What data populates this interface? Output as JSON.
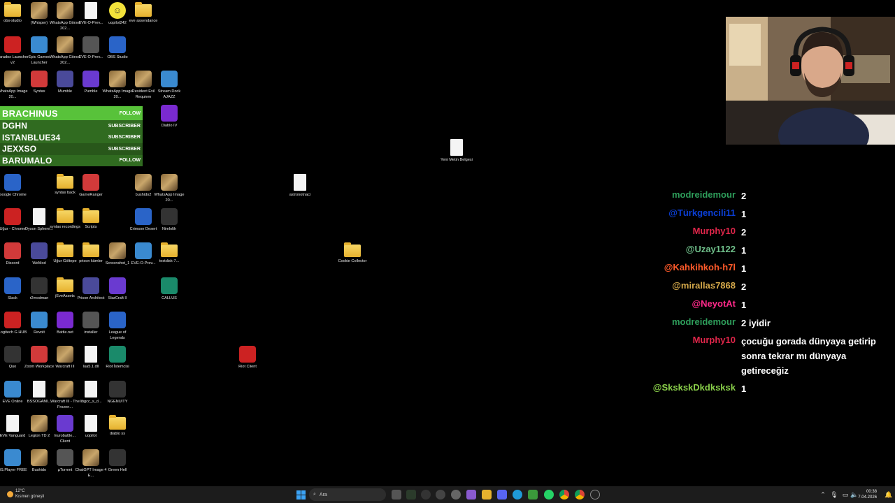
{
  "desktop_icons": [
    {
      "label": "obs-studio",
      "kind": "folder"
    },
    {
      "label": "(Whisper)",
      "kind": "photo"
    },
    {
      "label": "WhatsApp Görsel 202...",
      "kind": "photo"
    },
    {
      "label": "EVE-O-Prev...",
      "kind": "file"
    },
    {
      "label": "uopilot242",
      "kind": "smiley"
    },
    {
      "label": "eve assendance",
      "kind": "folder"
    },
    {
      "label": "Paradox Launcher v2",
      "kind": "app"
    },
    {
      "label": "Epic Games Launcher",
      "kind": "app"
    },
    {
      "label": "WhatsApp Görsel 202...",
      "kind": "photo"
    },
    {
      "label": "EVE-O-Prev...",
      "kind": "app"
    },
    {
      "label": "OBS Studio",
      "kind": "app"
    },
    {
      "label": "WhatsApp Image 20...",
      "kind": "photo"
    },
    {
      "label": "Syntax",
      "kind": "app"
    },
    {
      "label": "Mumble",
      "kind": "app"
    },
    {
      "label": "Pumble",
      "kind": "app"
    },
    {
      "label": "WhatsApp Image 20...",
      "kind": "photo"
    },
    {
      "label": "Resident Evil Requiem",
      "kind": "photo"
    },
    {
      "label": "Stream Dock AJAZZ",
      "kind": "app"
    },
    {
      "label": "Diablo IV",
      "kind": "app"
    },
    {
      "label": "Yeni Metin Belgesi",
      "kind": "file"
    },
    {
      "label": "Google Chrome",
      "kind": "app"
    },
    {
      "label": "syntax back",
      "kind": "folder"
    },
    {
      "label": "GameRanger",
      "kind": "app"
    },
    {
      "label": "bushido2",
      "kind": "photo"
    },
    {
      "label": "WhatsApp Image 20...",
      "kind": "photo"
    },
    {
      "label": "astronotnaci",
      "kind": "file"
    },
    {
      "label": "Uğur - Chrome",
      "kind": "app"
    },
    {
      "label": "Dyson Sphere...",
      "kind": "file"
    },
    {
      "label": "syntax recordings",
      "kind": "folder"
    },
    {
      "label": "Scripts",
      "kind": "folder"
    },
    {
      "label": "Crimson Desert",
      "kind": "app"
    },
    {
      "label": "Nimlolth",
      "kind": "app"
    },
    {
      "label": "Discord",
      "kind": "app"
    },
    {
      "label": "WeMod",
      "kind": "app"
    },
    {
      "label": "Uğur Göltepe",
      "kind": "folder"
    },
    {
      "label": "prison kümler",
      "kind": "folder"
    },
    {
      "label": "Screenshot_1",
      "kind": "photo"
    },
    {
      "label": "EVE-O-Prev...",
      "kind": "app"
    },
    {
      "label": "testdisk-7...",
      "kind": "folder"
    },
    {
      "label": "Cookie Collector",
      "kind": "folder"
    },
    {
      "label": "Slack",
      "kind": "app"
    },
    {
      "label": "r2modman",
      "kind": "app"
    },
    {
      "label": "jEveAssets",
      "kind": "folder"
    },
    {
      "label": "Prison Architect",
      "kind": "app"
    },
    {
      "label": "StarCraft II",
      "kind": "app"
    },
    {
      "label": "CALLUS",
      "kind": "app"
    },
    {
      "label": "Logitech G HUB",
      "kind": "app"
    },
    {
      "label": "Revolt",
      "kind": "app"
    },
    {
      "label": "Battle.net",
      "kind": "app"
    },
    {
      "label": "installer",
      "kind": "app"
    },
    {
      "label": "League of Legends",
      "kind": "app"
    },
    {
      "label": "Quo",
      "kind": "app"
    },
    {
      "label": "Zoom Workplace",
      "kind": "app"
    },
    {
      "label": "Warcraft III",
      "kind": "photo"
    },
    {
      "label": "lua5.1.dll",
      "kind": "file"
    },
    {
      "label": "Riot İstemcisi",
      "kind": "app"
    },
    {
      "label": "Riot Client",
      "kind": "app"
    },
    {
      "label": "EVE Online",
      "kind": "app"
    },
    {
      "label": "BSSOGAMI...",
      "kind": "file"
    },
    {
      "label": "Warcraft III - The Frozen...",
      "kind": "photo"
    },
    {
      "label": "libgcc_s_d...",
      "kind": "file"
    },
    {
      "label": "NGENUITY",
      "kind": "app"
    },
    {
      "label": "EVE Vanguard",
      "kind": "file"
    },
    {
      "label": "Legion TD 2",
      "kind": "photo"
    },
    {
      "label": "Eurobattle... Client",
      "kind": "app"
    },
    {
      "label": "uopilot",
      "kind": "file"
    },
    {
      "label": "diablo ss",
      "kind": "folder"
    },
    {
      "label": "BS.Player FREE",
      "kind": "app"
    },
    {
      "label": "Bushido",
      "kind": "photo"
    },
    {
      "label": "µTorrent",
      "kind": "app"
    },
    {
      "label": "ChatGPT Image 4 E...",
      "kind": "photo"
    },
    {
      "label": "Green Hell",
      "kind": "app"
    }
  ],
  "overlay": {
    "rows": [
      {
        "name": "BRACHINUS",
        "tag": "FOLLOW"
      },
      {
        "name": "DGHN",
        "tag": "SUBSCRIBER"
      },
      {
        "name": "ISTANBLUE34",
        "tag": "SUBSCRIBER"
      },
      {
        "name": "JEXXSO",
        "tag": "SUBSCRIBER"
      },
      {
        "name": "BARUMALO",
        "tag": "FOLLOW"
      }
    ]
  },
  "chat": {
    "messages": [
      {
        "user": "modreidemour",
        "text": "2",
        "color": "#2e9e5b"
      },
      {
        "user": "@Türkgencili11",
        "text": "1",
        "color": "#0b3fd6"
      },
      {
        "user": "Murphy10",
        "text": "2",
        "color": "#e0264a"
      },
      {
        "user": "@Uzay1122",
        "text": "1",
        "color": "#6fbf8a"
      },
      {
        "user": "@Kahkihkoh-h7l",
        "text": "1",
        "color": "#ff5a2a"
      },
      {
        "user": "@mirallas7868",
        "text": "2",
        "color": "#d4a84a"
      },
      {
        "user": "@NeyotAt",
        "text": "1",
        "color": "#ff2a8a"
      },
      {
        "user": "modreidemour",
        "text": "2 iyidir",
        "color": "#2e9e5b"
      },
      {
        "user": "Murphy10",
        "text": "çocuğu gorada dünyaya getirip sonra tekrar mı dünyaya getireceğiz",
        "color": "#e0264a"
      },
      {
        "user": "@SkskskDkdksksk",
        "text": "1",
        "color": "#8ad04a"
      }
    ]
  },
  "taskbar": {
    "search_placeholder": "Ara",
    "weather_temp": "12°C",
    "weather_desc": "Kısmen güneşli",
    "time": "00:38",
    "date": "7.04.2026"
  }
}
